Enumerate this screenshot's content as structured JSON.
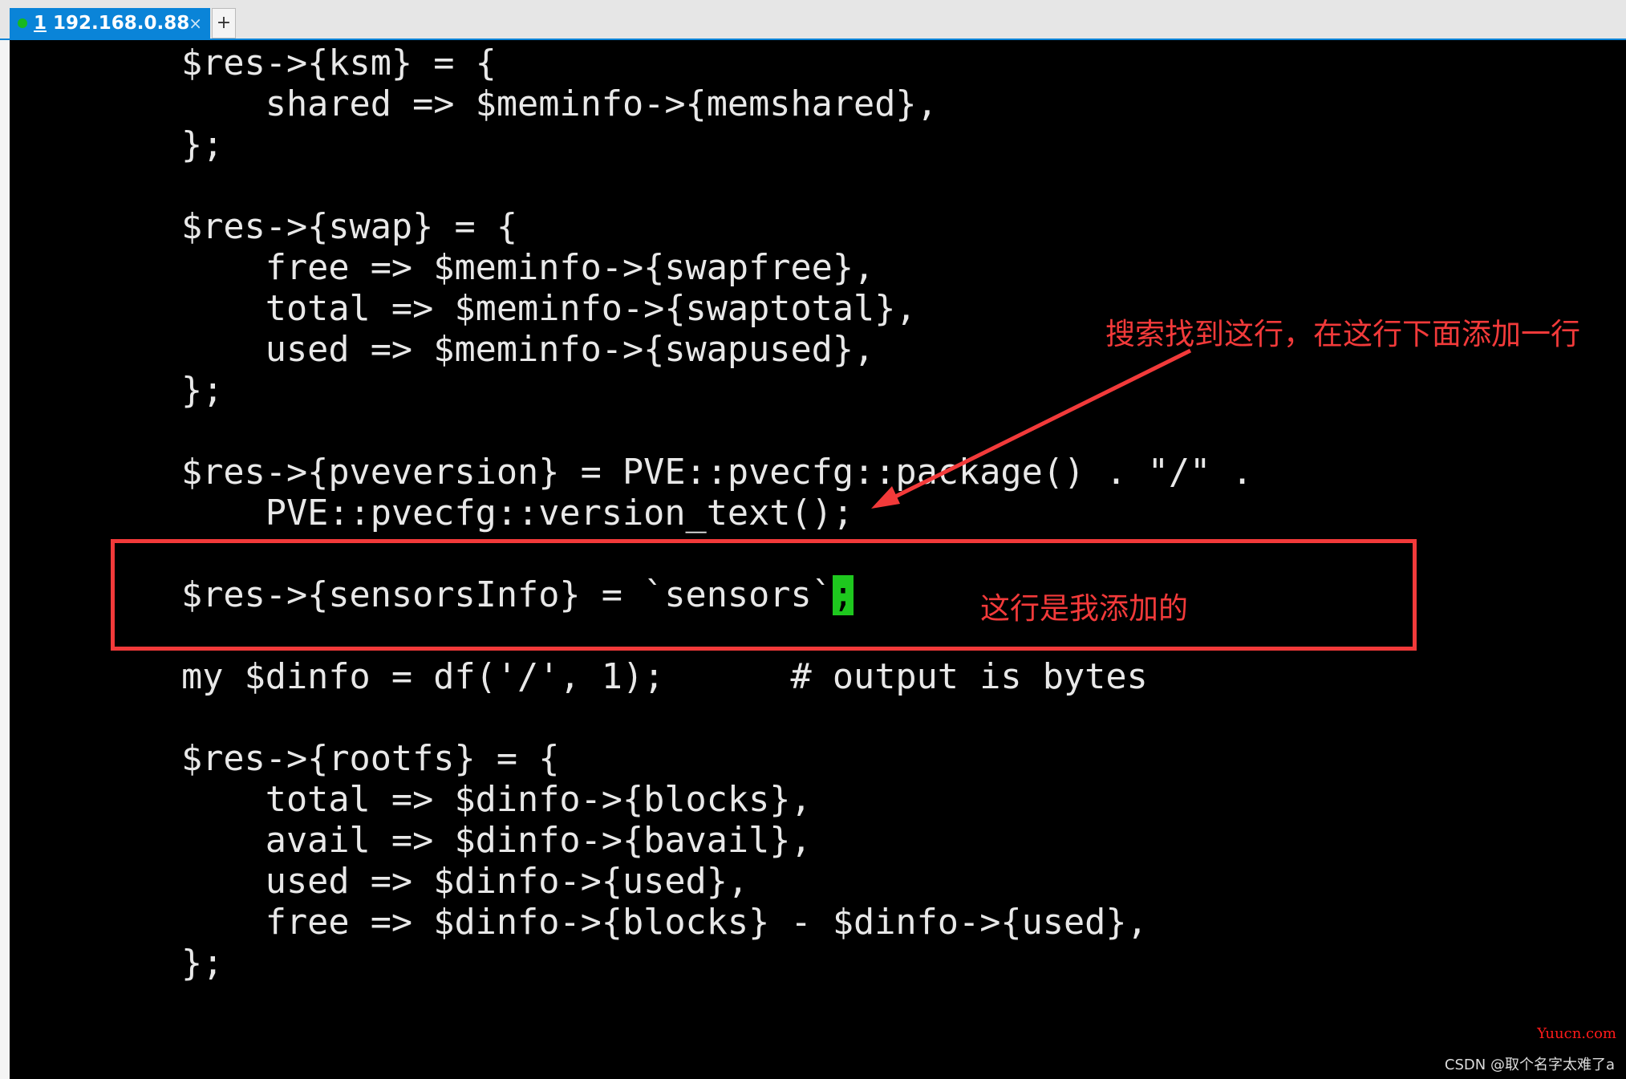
{
  "tab": {
    "index": "1",
    "title": "192.168.0.88",
    "close": "×",
    "new_tab": "+",
    "status_color": "#18b81e"
  },
  "terminal": {
    "lines": [
      "$res->{ksm} = {",
      "    shared => $meminfo->{memshared},",
      "};",
      "",
      "$res->{swap} = {",
      "    free => $meminfo->{swapfree},",
      "    total => $meminfo->{swaptotal},",
      "    used => $meminfo->{swapused},",
      "};",
      "",
      "$res->{pveversion} = PVE::pvecfg::package() . \"/\" .",
      "    PVE::pvecfg::version_text();",
      ""
    ],
    "added_line_prefix": "$res->{sensorsInfo} = `sensors`",
    "cursor_char": ";",
    "lines_after": [
      "",
      "my $dinfo = df('/', 1);      # output is bytes",
      "",
      "$res->{rootfs} = {",
      "    total => $dinfo->{blocks},",
      "    avail => $dinfo->{bavail},",
      "    used => $dinfo->{used},",
      "    free => $dinfo->{blocks} - $dinfo->{used},",
      "};"
    ]
  },
  "annotations": {
    "search_note": "搜索找到这行，在这行下面添加一行",
    "added_note": "这行是我添加的",
    "color": "#f23a3a"
  },
  "watermarks": {
    "site": "Yuucn.com",
    "author": "CSDN @取个名字太难了a"
  }
}
